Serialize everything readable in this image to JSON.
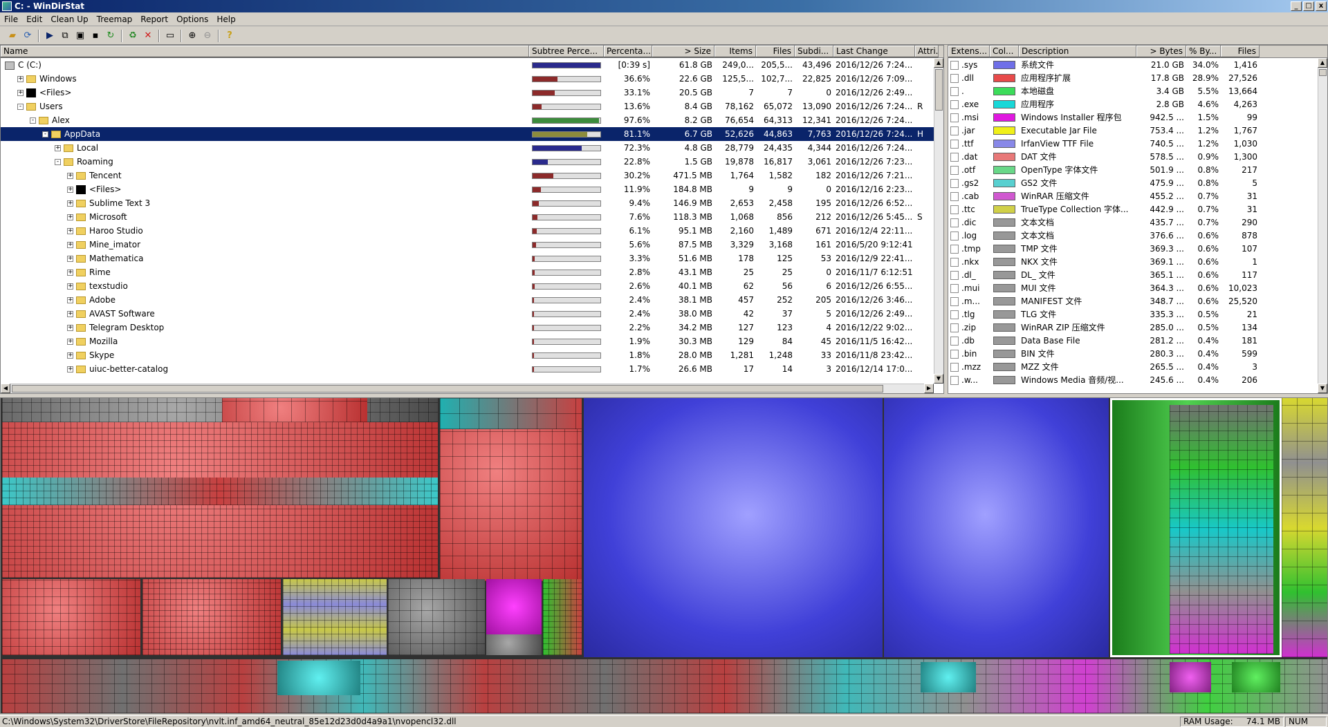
{
  "window": {
    "title": "C: - WinDirStat",
    "min": "_",
    "max": "□",
    "close": "x"
  },
  "menu": [
    "File",
    "Edit",
    "Clean Up",
    "Treemap",
    "Report",
    "Options",
    "Help"
  ],
  "tree_columns": [
    "Name",
    "Subtree Perce...",
    "Percenta...",
    "> Size",
    "Items",
    "Files",
    "Subdi...",
    "Last Change",
    "Attri..."
  ],
  "tree_rows": [
    {
      "indent": 0,
      "toggle": "",
      "icon": "drive",
      "name": "C (C:)",
      "sub": 100,
      "bar_color": "#2a2a8c",
      "pct": "[0:39 s]",
      "size": "61.8 GB",
      "items": "249,0...",
      "files": "205,5...",
      "subdirs": "43,496",
      "change": "2016/12/26  7:24...",
      "attr": ""
    },
    {
      "indent": 1,
      "toggle": "+",
      "icon": "folder",
      "name": "Windows",
      "sub": 36.6,
      "bar_color": "#8c2a2a",
      "pct": "36.6%",
      "size": "22.6 GB",
      "items": "125,5...",
      "files": "102,7...",
      "subdirs": "22,825",
      "change": "2016/12/26  7:09...",
      "attr": ""
    },
    {
      "indent": 1,
      "toggle": "+",
      "icon": "black",
      "name": "<Files>",
      "sub": 33.1,
      "bar_color": "#8c2a2a",
      "pct": "33.1%",
      "size": "20.5 GB",
      "items": "7",
      "files": "7",
      "subdirs": "0",
      "change": "2016/12/26  2:49...",
      "attr": ""
    },
    {
      "indent": 1,
      "toggle": "-",
      "icon": "folder",
      "name": "Users",
      "sub": 13.6,
      "bar_color": "#8c2a2a",
      "pct": "13.6%",
      "size": "8.4 GB",
      "items": "78,162",
      "files": "65,072",
      "subdirs": "13,090",
      "change": "2016/12/26  7:24...",
      "attr": "R"
    },
    {
      "indent": 2,
      "toggle": "-",
      "icon": "folder",
      "name": "Alex",
      "sub": 97.6,
      "bar_color": "#3c8c3c",
      "pct": "97.6%",
      "size": "8.2 GB",
      "items": "76,654",
      "files": "64,313",
      "subdirs": "12,341",
      "change": "2016/12/26  7:24...",
      "attr": ""
    },
    {
      "indent": 3,
      "toggle": "-",
      "icon": "folder",
      "name": "AppData",
      "sub": 81.1,
      "bar_color": "#8c8c3c",
      "pct": "81.1%",
      "size": "6.7 GB",
      "items": "52,626",
      "files": "44,863",
      "subdirs": "7,763",
      "change": "2016/12/26  7:24...",
      "attr": "H",
      "selected": true
    },
    {
      "indent": 4,
      "toggle": "+",
      "icon": "folder",
      "name": "Local",
      "sub": 72.3,
      "bar_color": "#2a2a8c",
      "pct": "72.3%",
      "size": "4.8 GB",
      "items": "28,779",
      "files": "24,435",
      "subdirs": "4,344",
      "change": "2016/12/26  7:24...",
      "attr": ""
    },
    {
      "indent": 4,
      "toggle": "-",
      "icon": "folder",
      "name": "Roaming",
      "sub": 22.8,
      "bar_color": "#2a2a8c",
      "pct": "22.8%",
      "size": "1.5 GB",
      "items": "19,878",
      "files": "16,817",
      "subdirs": "3,061",
      "change": "2016/12/26  7:23...",
      "attr": ""
    },
    {
      "indent": 5,
      "toggle": "+",
      "icon": "folder",
      "name": "Tencent",
      "sub": 30.2,
      "bar_color": "#8c2a2a",
      "pct": "30.2%",
      "size": "471.5 MB",
      "items": "1,764",
      "files": "1,582",
      "subdirs": "182",
      "change": "2016/12/26  7:21...",
      "attr": ""
    },
    {
      "indent": 5,
      "toggle": "+",
      "icon": "black",
      "name": "<Files>",
      "sub": 11.9,
      "bar_color": "#8c2a2a",
      "pct": "11.9%",
      "size": "184.8 MB",
      "items": "9",
      "files": "9",
      "subdirs": "0",
      "change": "2016/12/16  2:23...",
      "attr": ""
    },
    {
      "indent": 5,
      "toggle": "+",
      "icon": "folder",
      "name": "Sublime Text 3",
      "sub": 9.4,
      "bar_color": "#8c2a2a",
      "pct": "9.4%",
      "size": "146.9 MB",
      "items": "2,653",
      "files": "2,458",
      "subdirs": "195",
      "change": "2016/12/26  6:52...",
      "attr": ""
    },
    {
      "indent": 5,
      "toggle": "+",
      "icon": "folder",
      "name": "Microsoft",
      "sub": 7.6,
      "bar_color": "#8c2a2a",
      "pct": "7.6%",
      "size": "118.3 MB",
      "items": "1,068",
      "files": "856",
      "subdirs": "212",
      "change": "2016/12/26  5:45...",
      "attr": "S"
    },
    {
      "indent": 5,
      "toggle": "+",
      "icon": "folder",
      "name": "Haroo Studio",
      "sub": 6.1,
      "bar_color": "#8c2a2a",
      "pct": "6.1%",
      "size": "95.1 MB",
      "items": "2,160",
      "files": "1,489",
      "subdirs": "671",
      "change": "2016/12/4  22:11...",
      "attr": ""
    },
    {
      "indent": 5,
      "toggle": "+",
      "icon": "folder",
      "name": "Mine_imator",
      "sub": 5.6,
      "bar_color": "#8c2a2a",
      "pct": "5.6%",
      "size": "87.5 MB",
      "items": "3,329",
      "files": "3,168",
      "subdirs": "161",
      "change": "2016/5/20  9:12:41",
      "attr": ""
    },
    {
      "indent": 5,
      "toggle": "+",
      "icon": "folder",
      "name": "Mathematica",
      "sub": 3.3,
      "bar_color": "#8c2a2a",
      "pct": "3.3%",
      "size": "51.6 MB",
      "items": "178",
      "files": "125",
      "subdirs": "53",
      "change": "2016/12/9  22:41...",
      "attr": ""
    },
    {
      "indent": 5,
      "toggle": "+",
      "icon": "folder",
      "name": "Rime",
      "sub": 2.8,
      "bar_color": "#8c2a2a",
      "pct": "2.8%",
      "size": "43.1 MB",
      "items": "25",
      "files": "25",
      "subdirs": "0",
      "change": "2016/11/7  6:12:51",
      "attr": ""
    },
    {
      "indent": 5,
      "toggle": "+",
      "icon": "folder",
      "name": "texstudio",
      "sub": 2.6,
      "bar_color": "#8c2a2a",
      "pct": "2.6%",
      "size": "40.1 MB",
      "items": "62",
      "files": "56",
      "subdirs": "6",
      "change": "2016/12/26  6:55...",
      "attr": ""
    },
    {
      "indent": 5,
      "toggle": "+",
      "icon": "folder",
      "name": "Adobe",
      "sub": 2.4,
      "bar_color": "#8c2a2a",
      "pct": "2.4%",
      "size": "38.1 MB",
      "items": "457",
      "files": "252",
      "subdirs": "205",
      "change": "2016/12/26  3:46...",
      "attr": ""
    },
    {
      "indent": 5,
      "toggle": "+",
      "icon": "folder",
      "name": "AVAST Software",
      "sub": 2.4,
      "bar_color": "#8c2a2a",
      "pct": "2.4%",
      "size": "38.0 MB",
      "items": "42",
      "files": "37",
      "subdirs": "5",
      "change": "2016/12/26  2:49...",
      "attr": ""
    },
    {
      "indent": 5,
      "toggle": "+",
      "icon": "folder",
      "name": "Telegram Desktop",
      "sub": 2.2,
      "bar_color": "#8c2a2a",
      "pct": "2.2%",
      "size": "34.2 MB",
      "items": "127",
      "files": "123",
      "subdirs": "4",
      "change": "2016/12/22  9:02...",
      "attr": ""
    },
    {
      "indent": 5,
      "toggle": "+",
      "icon": "folder",
      "name": "Mozilla",
      "sub": 1.9,
      "bar_color": "#8c2a2a",
      "pct": "1.9%",
      "size": "30.3 MB",
      "items": "129",
      "files": "84",
      "subdirs": "45",
      "change": "2016/11/5  16:42...",
      "attr": ""
    },
    {
      "indent": 5,
      "toggle": "+",
      "icon": "folder",
      "name": "Skype",
      "sub": 1.8,
      "bar_color": "#8c2a2a",
      "pct": "1.8%",
      "size": "28.0 MB",
      "items": "1,281",
      "files": "1,248",
      "subdirs": "33",
      "change": "2016/11/8  23:42...",
      "attr": ""
    },
    {
      "indent": 5,
      "toggle": "+",
      "icon": "folder",
      "name": "uiuc-better-catalog",
      "sub": 1.7,
      "bar_color": "#8c2a2a",
      "pct": "1.7%",
      "size": "26.6 MB",
      "items": "17",
      "files": "14",
      "subdirs": "3",
      "change": "2016/12/14  17:0...",
      "attr": ""
    }
  ],
  "ext_columns": [
    "Extens...",
    "Col...",
    "Description",
    "> Bytes",
    "% By...",
    "Files"
  ],
  "ext_rows": [
    {
      "ext": ".sys",
      "color": "#6f6fe8",
      "desc": "系统文件",
      "bytes": "21.0 GB",
      "pct": "34.0%",
      "files": "1,416"
    },
    {
      "ext": ".dll",
      "color": "#e84a4a",
      "desc": "应用程序扩展",
      "bytes": "17.8 GB",
      "pct": "28.9%",
      "files": "27,526"
    },
    {
      "ext": ".",
      "color": "#3cdc5a",
      "desc": "本地磁盘",
      "bytes": "3.4 GB",
      "pct": "5.5%",
      "files": "13,664"
    },
    {
      "ext": ".exe",
      "color": "#18d8d8",
      "desc": "应用程序",
      "bytes": "2.8 GB",
      "pct": "4.6%",
      "files": "4,263"
    },
    {
      "ext": ".msi",
      "color": "#e018e0",
      "desc": "Windows Installer 程序包",
      "bytes": "942.5 ...",
      "pct": "1.5%",
      "files": "99"
    },
    {
      "ext": ".jar",
      "color": "#f0f018",
      "desc": "Executable Jar File",
      "bytes": "753.4 ...",
      "pct": "1.2%",
      "files": "1,767"
    },
    {
      "ext": ".ttf",
      "color": "#8888e8",
      "desc": "IrfanView TTF File",
      "bytes": "740.5 ...",
      "pct": "1.2%",
      "files": "1,030"
    },
    {
      "ext": ".dat",
      "color": "#e87878",
      "desc": "DAT 文件",
      "bytes": "578.5 ...",
      "pct": "0.9%",
      "files": "1,300"
    },
    {
      "ext": ".otf",
      "color": "#68d888",
      "desc": "OpenType 字体文件",
      "bytes": "501.9 ...",
      "pct": "0.8%",
      "files": "217"
    },
    {
      "ext": ".gs2",
      "color": "#58d0d0",
      "desc": "GS2 文件",
      "bytes": "475.9 ...",
      "pct": "0.8%",
      "files": "5"
    },
    {
      "ext": ".cab",
      "color": "#d058d0",
      "desc": "WinRAR 压缩文件",
      "bytes": "455.2 ...",
      "pct": "0.7%",
      "files": "31"
    },
    {
      "ext": ".ttc",
      "color": "#d0d048",
      "desc": "TrueType Collection 字体...",
      "bytes": "442.9 ...",
      "pct": "0.7%",
      "files": "31"
    },
    {
      "ext": ".dic",
      "color": "#989898",
      "desc": "文本文档",
      "bytes": "435.7 ...",
      "pct": "0.7%",
      "files": "290"
    },
    {
      "ext": ".log",
      "color": "#989898",
      "desc": "文本文档",
      "bytes": "376.6 ...",
      "pct": "0.6%",
      "files": "878"
    },
    {
      "ext": ".tmp",
      "color": "#989898",
      "desc": "TMP 文件",
      "bytes": "369.3 ...",
      "pct": "0.6%",
      "files": "107"
    },
    {
      "ext": ".nkx",
      "color": "#989898",
      "desc": "NKX 文件",
      "bytes": "369.1 ...",
      "pct": "0.6%",
      "files": "1"
    },
    {
      "ext": ".dl_",
      "color": "#989898",
      "desc": "DL_ 文件",
      "bytes": "365.1 ...",
      "pct": "0.6%",
      "files": "117"
    },
    {
      "ext": ".mui",
      "color": "#989898",
      "desc": "MUI 文件",
      "bytes": "364.3 ...",
      "pct": "0.6%",
      "files": "10,023"
    },
    {
      "ext": ".m...",
      "color": "#989898",
      "desc": "MANIFEST 文件",
      "bytes": "348.7 ...",
      "pct": "0.6%",
      "files": "25,520"
    },
    {
      "ext": ".tlg",
      "color": "#989898",
      "desc": "TLG 文件",
      "bytes": "335.3 ...",
      "pct": "0.5%",
      "files": "21"
    },
    {
      "ext": ".zip",
      "color": "#989898",
      "desc": "WinRAR ZIP 压缩文件",
      "bytes": "285.0 ...",
      "pct": "0.5%",
      "files": "134"
    },
    {
      "ext": ".db",
      "color": "#989898",
      "desc": "Data Base File",
      "bytes": "281.2 ...",
      "pct": "0.4%",
      "files": "181"
    },
    {
      "ext": ".bin",
      "color": "#989898",
      "desc": "BIN 文件",
      "bytes": "280.3 ...",
      "pct": "0.4%",
      "files": "599"
    },
    {
      "ext": ".mzz",
      "color": "#989898",
      "desc": "MZZ 文件",
      "bytes": "265.5 ...",
      "pct": "0.4%",
      "files": "3"
    },
    {
      "ext": ".w...",
      "color": "#989898",
      "desc": "Windows Media 音频/视...",
      "bytes": "245.6 ...",
      "pct": "0.4%",
      "files": "206"
    }
  ],
  "status": {
    "path": "C:\\Windows\\System32\\DriverStore\\FileRepository\\nvlt.inf_amd64_neutral_85e12d23d0d4a9a1\\nvopencl32.dll",
    "ram_label": "RAM Usage:",
    "ram_value": "74.1 MB",
    "num": "NUM"
  }
}
